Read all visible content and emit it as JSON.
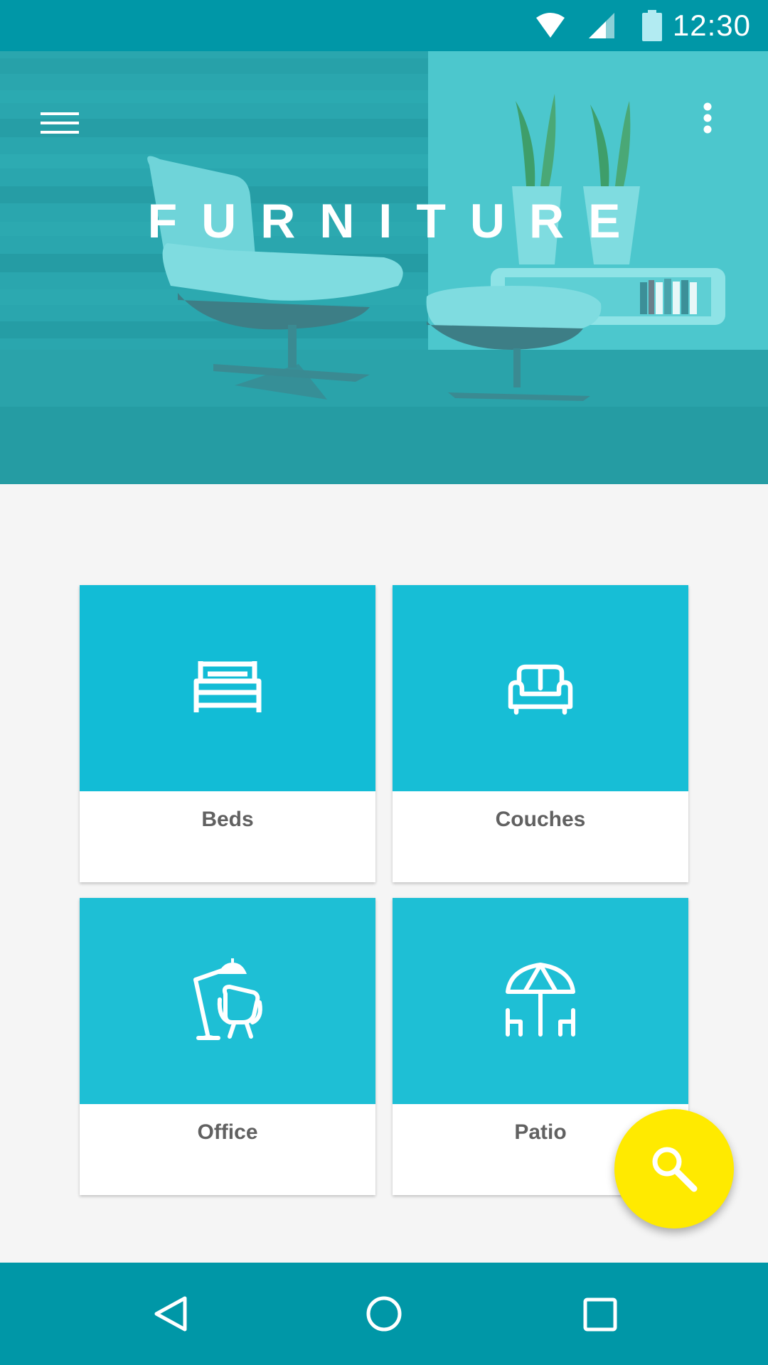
{
  "status_bar": {
    "time": "12:30",
    "icons": [
      "wifi-icon",
      "cellular-signal-icon",
      "battery-icon"
    ]
  },
  "header": {
    "title": "FURNITURE",
    "menu_icon": "menu-icon",
    "overflow_icon": "more-vert-icon",
    "background": "hero-furniture-photo"
  },
  "categories": [
    {
      "label": "Beds",
      "icon": "bed-icon",
      "color": "#12bcd6"
    },
    {
      "label": "Couches",
      "icon": "couch-icon",
      "color": "#17bed6"
    },
    {
      "label": "Office",
      "icon": "office-lamp-chair-icon",
      "color": "#1ebfd5"
    },
    {
      "label": "Patio",
      "icon": "patio-umbrella-icon",
      "color": "#1ebfd5"
    }
  ],
  "fab": {
    "icon": "search-icon",
    "color": "#ffea00"
  },
  "nav_bar": {
    "icons": [
      "back-icon",
      "home-icon",
      "recents-icon"
    ]
  },
  "colors": {
    "primary_dark": "#0097a7",
    "background": "#f5f5f5",
    "text_secondary": "#616161"
  }
}
